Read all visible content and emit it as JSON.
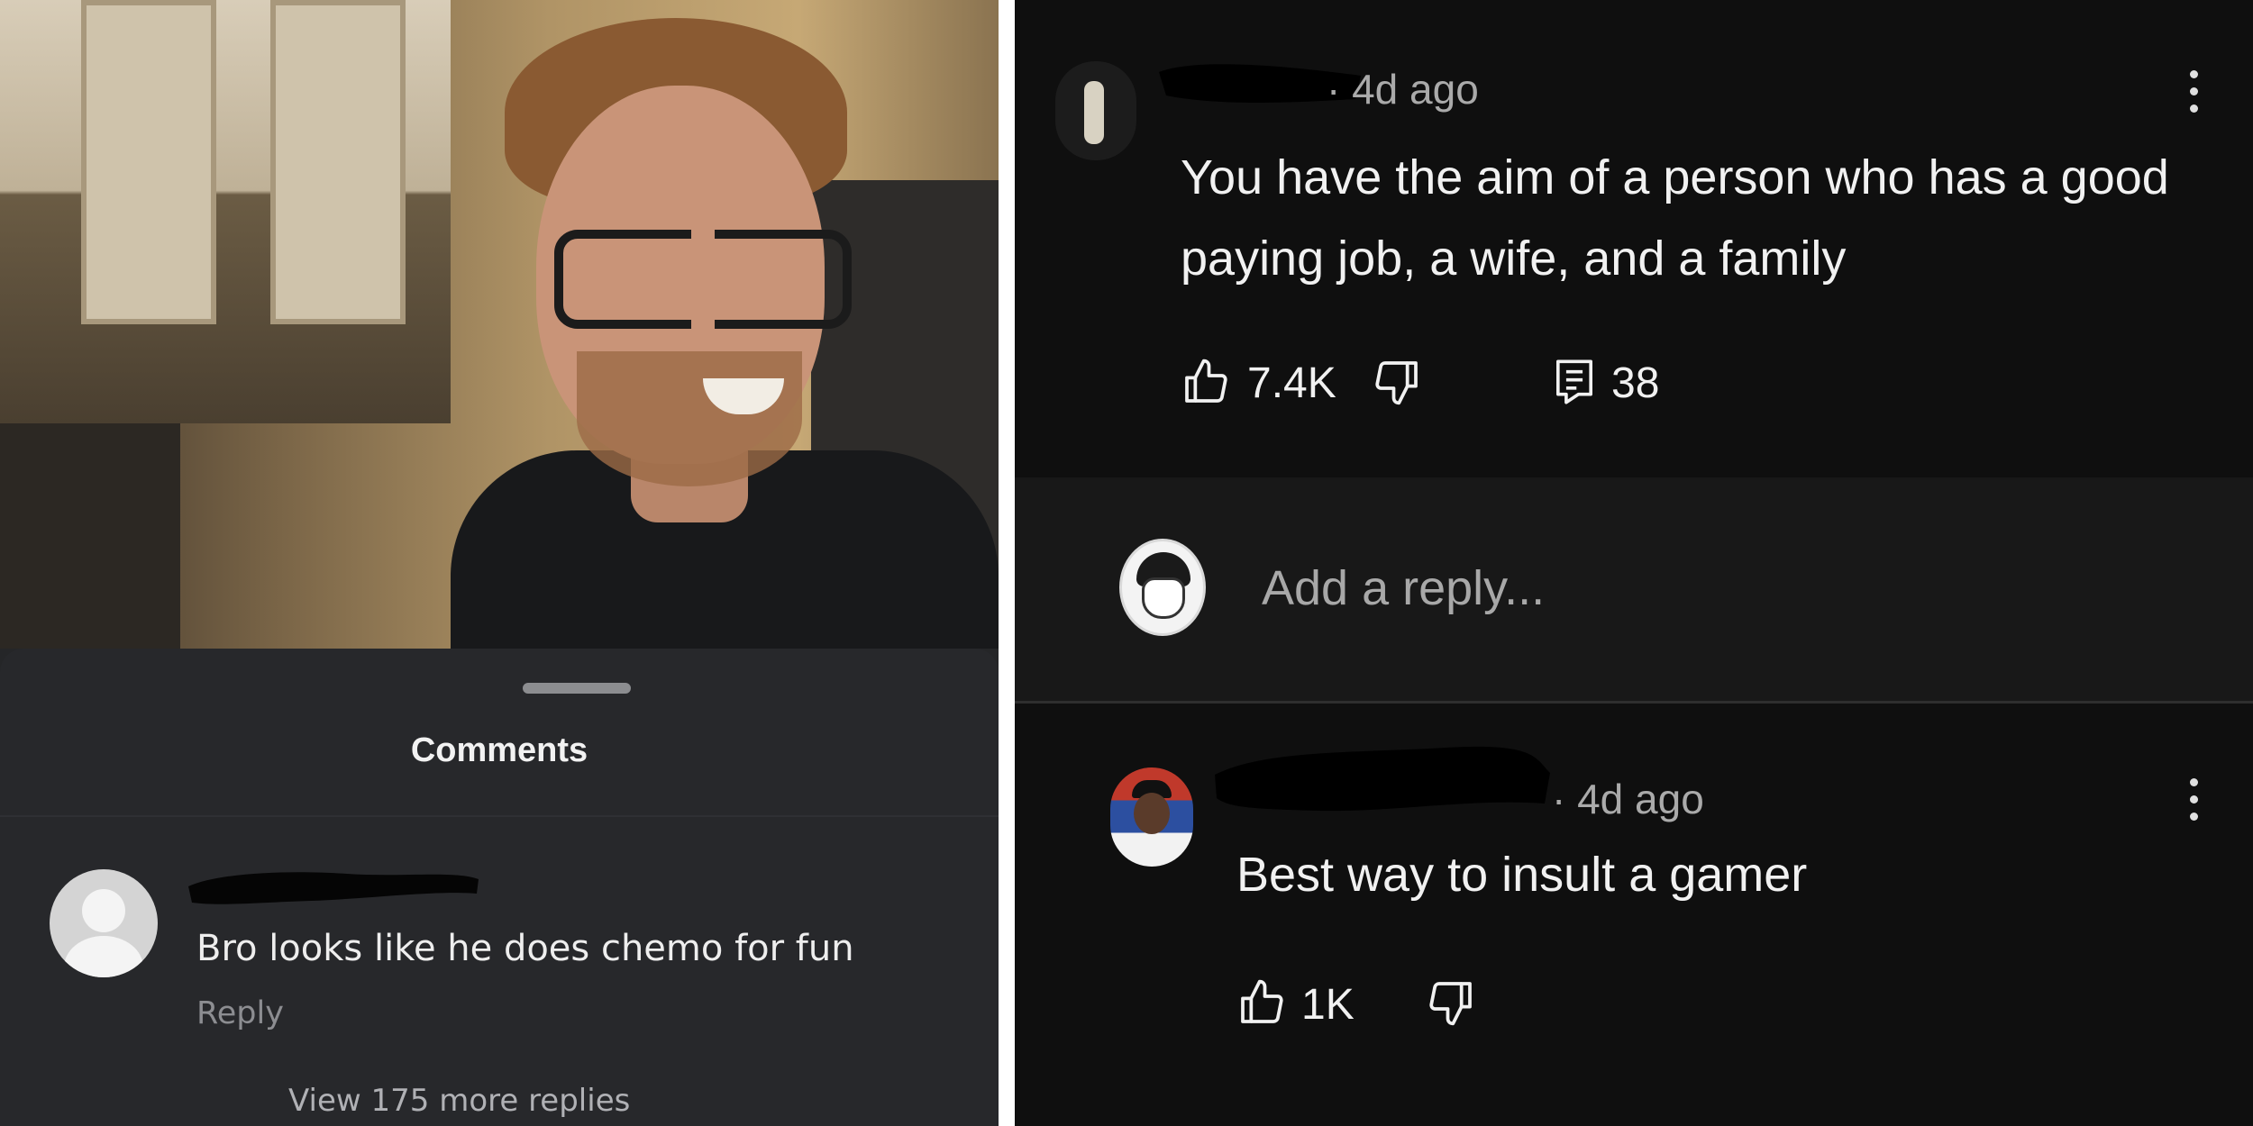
{
  "left": {
    "sheet_title": "Comments",
    "comment": {
      "text": "Bro looks like he does chemo for fun",
      "reply_label": "Reply"
    },
    "view_more_label": "View 175 more replies"
  },
  "right": {
    "comments": [
      {
        "time": "· 4d ago",
        "text": "You have the aim of a person who has a good paying job, a wife, and a family",
        "likes": "7.4K",
        "reply_count": "38",
        "icons": [
          "avatar-skeleton",
          "thumbs-up-icon",
          "thumbs-down-icon",
          "replies-icon",
          "more-vert-icon"
        ]
      },
      {
        "time": "· 4d ago",
        "text": "Best way to insult a gamer",
        "likes": "1K",
        "icons": [
          "avatar-flag",
          "thumbs-up-icon",
          "thumbs-down-icon",
          "more-vert-icon"
        ]
      }
    ],
    "reply_box": {
      "placeholder": "Add a reply..."
    }
  },
  "colors": {
    "left_sheet_bg": "#27282b",
    "right_bg": "#0f0f0f",
    "reply_area_bg": "#181818",
    "text_primary": "#f1f1f1",
    "text_secondary": "#aaaaaa"
  }
}
